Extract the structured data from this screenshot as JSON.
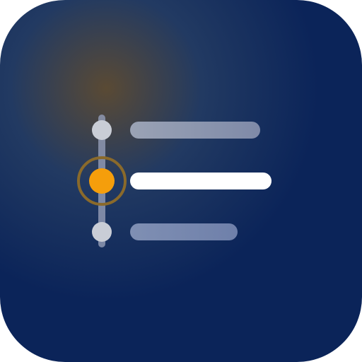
{
  "app_icon": {
    "icon": "timeline-list-icon",
    "colors": {
      "background": "#0b2459",
      "glow": "#8a6a2b",
      "accent": "#f59e0b",
      "accent_ring": "#8a6a2b",
      "muted": "#c8ccd6",
      "active_bar": "#ffffff"
    },
    "rows": [
      {
        "name": "item-1",
        "state": "inactive"
      },
      {
        "name": "item-2",
        "state": "active"
      },
      {
        "name": "item-3",
        "state": "inactive"
      }
    ]
  }
}
